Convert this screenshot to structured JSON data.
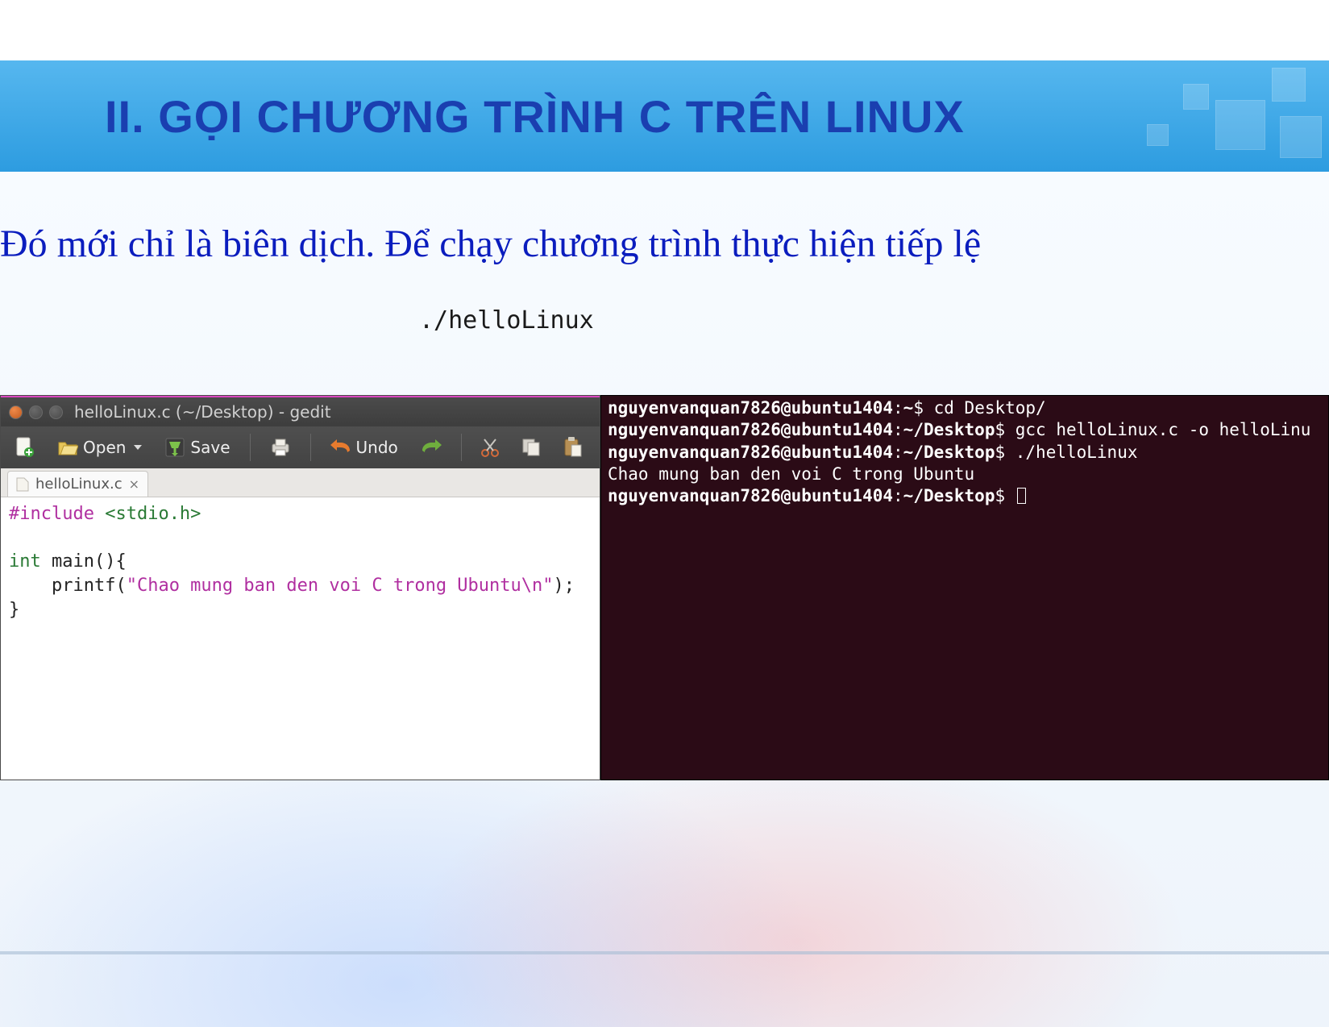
{
  "header": {
    "title": "II. GỌI CHƯƠNG TRÌNH C TRÊN LINUX"
  },
  "intro_text": "Đó mới chỉ là biên dịch. Để chạy chương trình thực hiện tiếp lệ",
  "command": "./helloLinux",
  "gedit": {
    "window_title": "helloLinux.c (~/Desktop) - gedit",
    "toolbar": {
      "open_label": "Open",
      "save_label": "Save",
      "undo_label": "Undo"
    },
    "tab_label": "helloLinux.c",
    "code": {
      "include_kw": "#include",
      "include_hdr": "<stdio.h>",
      "int_kw": "int",
      "main_sig": " main(){",
      "printf_pre": "    printf(",
      "string_open": "\"",
      "string_body": "Chao mung ban den voi C trong Ubuntu",
      "string_esc": "\\n",
      "string_close": "\"",
      "printf_post": ");",
      "close_brace": "}"
    }
  },
  "terminal": {
    "user_host": "nguyenvanquan7826@ubuntu1404",
    "home_path": "~",
    "desktop_path": "~/Desktop",
    "line1_cmd": "cd Desktop/",
    "line2_cmd": "gcc helloLinux.c -o helloLinu",
    "line3_cmd": "./helloLinux",
    "output": "Chao mung ban den voi C trong Ubuntu"
  }
}
